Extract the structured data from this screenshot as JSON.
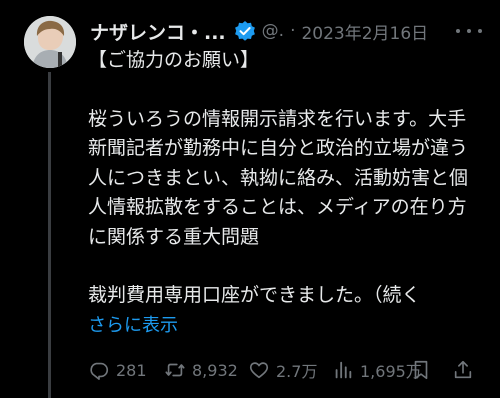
{
  "tweet": {
    "display_name": "ナザレンコ・...",
    "handle": "@.",
    "separator": "·",
    "date": "2023年2月16日",
    "text_title": "【ご協力のお願い】",
    "text_body": "桜ういろうの情報開示請求を行います。大手\n新聞記者が勤務中に自分と政治的立場が違う\n人につきまとい、執拗に絡み、活動妨害と個\n人情報拡散をすることは、メディアの在り方\nに関係する重大問題",
    "text_tail": "裁判費用専用口座ができました。（続く",
    "show_more": "さらに表示"
  },
  "actions": {
    "replies": "281",
    "retweets": "8,932",
    "likes": "2.7万",
    "views": "1,695万"
  },
  "colors": {
    "background": "#000000",
    "text": "#e7e9ea",
    "muted": "#71767b",
    "link": "#1d9bf0",
    "verified": "#1d9bf0"
  },
  "icons": [
    "verified-badge-icon",
    "more-icon",
    "reply-icon",
    "retweet-icon",
    "like-icon",
    "views-icon",
    "bookmark-icon",
    "share-icon"
  ]
}
